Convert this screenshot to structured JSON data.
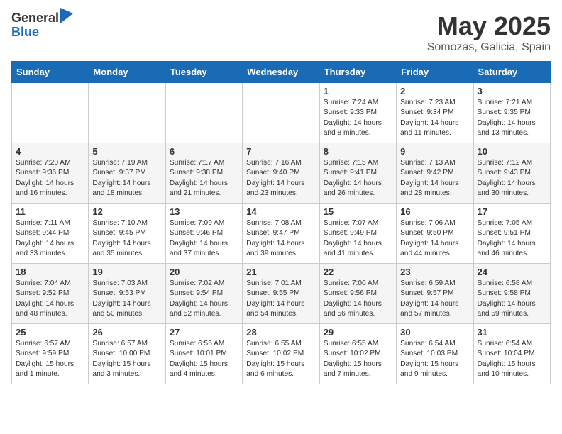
{
  "logo": {
    "general": "General",
    "blue": "Blue"
  },
  "title": "May 2025",
  "subtitle": "Somozas, Galicia, Spain",
  "headers": [
    "Sunday",
    "Monday",
    "Tuesday",
    "Wednesday",
    "Thursday",
    "Friday",
    "Saturday"
  ],
  "weeks": [
    [
      {
        "day": "",
        "info": ""
      },
      {
        "day": "",
        "info": ""
      },
      {
        "day": "",
        "info": ""
      },
      {
        "day": "",
        "info": ""
      },
      {
        "day": "1",
        "info": "Sunrise: 7:24 AM\nSunset: 9:33 PM\nDaylight: 14 hours\nand 8 minutes."
      },
      {
        "day": "2",
        "info": "Sunrise: 7:23 AM\nSunset: 9:34 PM\nDaylight: 14 hours\nand 11 minutes."
      },
      {
        "day": "3",
        "info": "Sunrise: 7:21 AM\nSunset: 9:35 PM\nDaylight: 14 hours\nand 13 minutes."
      }
    ],
    [
      {
        "day": "4",
        "info": "Sunrise: 7:20 AM\nSunset: 9:36 PM\nDaylight: 14 hours\nand 16 minutes."
      },
      {
        "day": "5",
        "info": "Sunrise: 7:19 AM\nSunset: 9:37 PM\nDaylight: 14 hours\nand 18 minutes."
      },
      {
        "day": "6",
        "info": "Sunrise: 7:17 AM\nSunset: 9:38 PM\nDaylight: 14 hours\nand 21 minutes."
      },
      {
        "day": "7",
        "info": "Sunrise: 7:16 AM\nSunset: 9:40 PM\nDaylight: 14 hours\nand 23 minutes."
      },
      {
        "day": "8",
        "info": "Sunrise: 7:15 AM\nSunset: 9:41 PM\nDaylight: 14 hours\nand 26 minutes."
      },
      {
        "day": "9",
        "info": "Sunrise: 7:13 AM\nSunset: 9:42 PM\nDaylight: 14 hours\nand 28 minutes."
      },
      {
        "day": "10",
        "info": "Sunrise: 7:12 AM\nSunset: 9:43 PM\nDaylight: 14 hours\nand 30 minutes."
      }
    ],
    [
      {
        "day": "11",
        "info": "Sunrise: 7:11 AM\nSunset: 9:44 PM\nDaylight: 14 hours\nand 33 minutes."
      },
      {
        "day": "12",
        "info": "Sunrise: 7:10 AM\nSunset: 9:45 PM\nDaylight: 14 hours\nand 35 minutes."
      },
      {
        "day": "13",
        "info": "Sunrise: 7:09 AM\nSunset: 9:46 PM\nDaylight: 14 hours\nand 37 minutes."
      },
      {
        "day": "14",
        "info": "Sunrise: 7:08 AM\nSunset: 9:47 PM\nDaylight: 14 hours\nand 39 minutes."
      },
      {
        "day": "15",
        "info": "Sunrise: 7:07 AM\nSunset: 9:49 PM\nDaylight: 14 hours\nand 41 minutes."
      },
      {
        "day": "16",
        "info": "Sunrise: 7:06 AM\nSunset: 9:50 PM\nDaylight: 14 hours\nand 44 minutes."
      },
      {
        "day": "17",
        "info": "Sunrise: 7:05 AM\nSunset: 9:51 PM\nDaylight: 14 hours\nand 46 minutes."
      }
    ],
    [
      {
        "day": "18",
        "info": "Sunrise: 7:04 AM\nSunset: 9:52 PM\nDaylight: 14 hours\nand 48 minutes."
      },
      {
        "day": "19",
        "info": "Sunrise: 7:03 AM\nSunset: 9:53 PM\nDaylight: 14 hours\nand 50 minutes."
      },
      {
        "day": "20",
        "info": "Sunrise: 7:02 AM\nSunset: 9:54 PM\nDaylight: 14 hours\nand 52 minutes."
      },
      {
        "day": "21",
        "info": "Sunrise: 7:01 AM\nSunset: 9:55 PM\nDaylight: 14 hours\nand 54 minutes."
      },
      {
        "day": "22",
        "info": "Sunrise: 7:00 AM\nSunset: 9:56 PM\nDaylight: 14 hours\nand 56 minutes."
      },
      {
        "day": "23",
        "info": "Sunrise: 6:59 AM\nSunset: 9:57 PM\nDaylight: 14 hours\nand 57 minutes."
      },
      {
        "day": "24",
        "info": "Sunrise: 6:58 AM\nSunset: 9:58 PM\nDaylight: 14 hours\nand 59 minutes."
      }
    ],
    [
      {
        "day": "25",
        "info": "Sunrise: 6:57 AM\nSunset: 9:59 PM\nDaylight: 15 hours\nand 1 minute."
      },
      {
        "day": "26",
        "info": "Sunrise: 6:57 AM\nSunset: 10:00 PM\nDaylight: 15 hours\nand 3 minutes."
      },
      {
        "day": "27",
        "info": "Sunrise: 6:56 AM\nSunset: 10:01 PM\nDaylight: 15 hours\nand 4 minutes."
      },
      {
        "day": "28",
        "info": "Sunrise: 6:55 AM\nSunset: 10:02 PM\nDaylight: 15 hours\nand 6 minutes."
      },
      {
        "day": "29",
        "info": "Sunrise: 6:55 AM\nSunset: 10:02 PM\nDaylight: 15 hours\nand 7 minutes."
      },
      {
        "day": "30",
        "info": "Sunrise: 6:54 AM\nSunset: 10:03 PM\nDaylight: 15 hours\nand 9 minutes."
      },
      {
        "day": "31",
        "info": "Sunrise: 6:54 AM\nSunset: 10:04 PM\nDaylight: 15 hours\nand 10 minutes."
      }
    ]
  ]
}
